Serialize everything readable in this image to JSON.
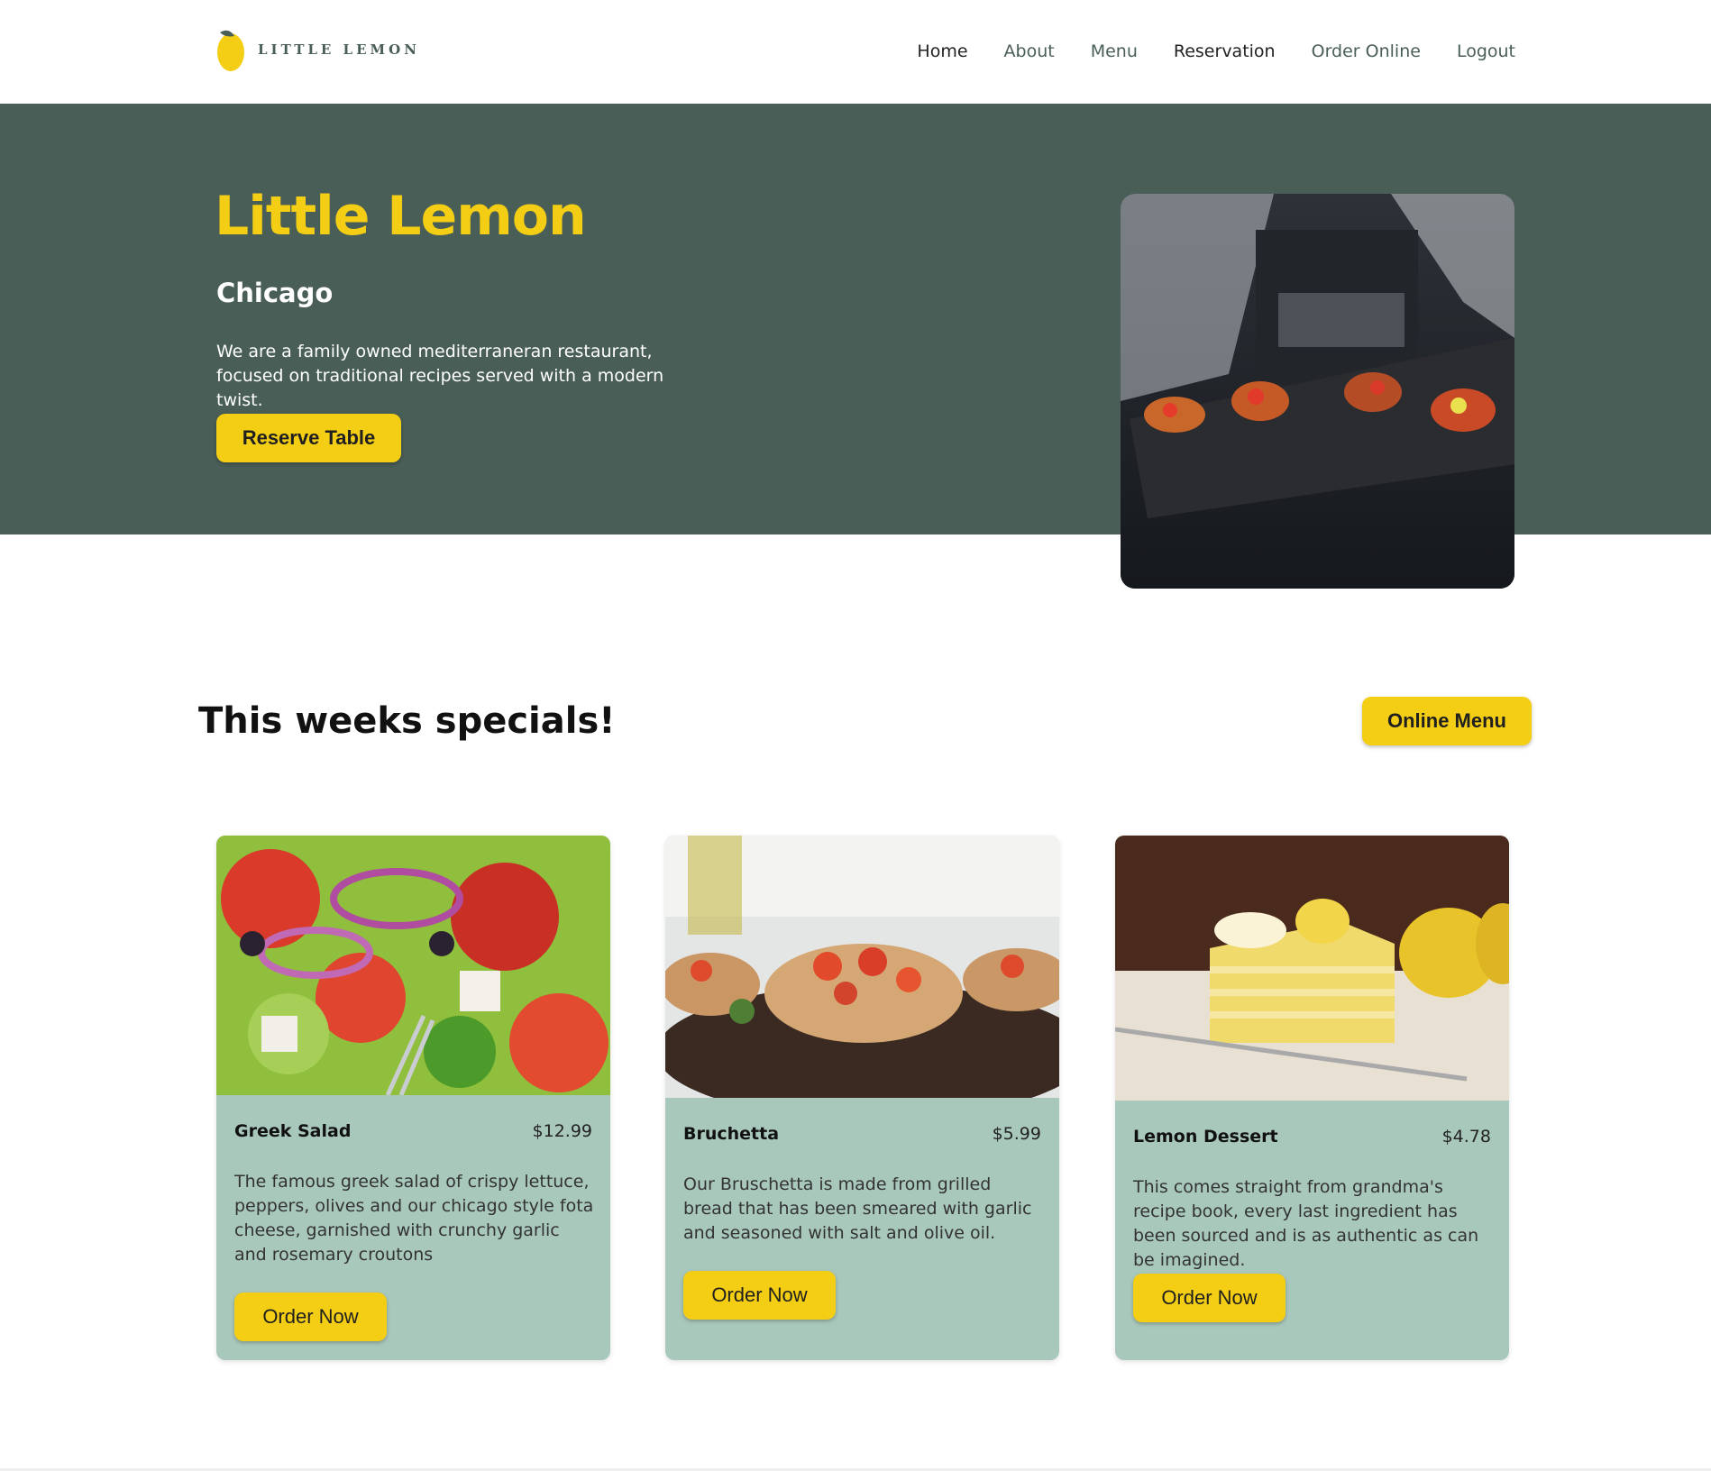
{
  "brand": {
    "name": "LITTLE LEMON"
  },
  "nav": [
    "Home",
    "About",
    "Menu",
    "Reservation",
    "Order Online",
    "Logout"
  ],
  "hero": {
    "title": "Little Lemon",
    "city": "Chicago",
    "description": "We are a family owned mediterraneran restaurant, focused on traditional recipes served with a modern twist.",
    "reserve_label": "Reserve Table"
  },
  "specials": {
    "title": "This weeks specials!",
    "online_menu_label": "Online Menu",
    "items": [
      {
        "name": "Greek Salad",
        "price": "$12.99",
        "description": "The famous greek salad of crispy lettuce, peppers, olives and our chicago style fota cheese, garnished with crunchy garlic and rosemary croutons",
        "order_label": "Order Now"
      },
      {
        "name": "Bruchetta",
        "price": "$5.99",
        "description": "Our Bruschetta is made from grilled bread that has been smeared with garlic and seasoned with salt and olive oil.",
        "order_label": "Order Now"
      },
      {
        "name": "Lemon Dessert",
        "price": "$4.78",
        "description": "This comes straight from grandma's recipe book, every last ingredient has been sourced and is as authentic as can be imagined.",
        "order_label": "Order Now"
      }
    ]
  },
  "colors": {
    "primary_green": "#495e57",
    "primary_yellow": "#f4ce14",
    "card_bg": "#a9c8bc"
  }
}
